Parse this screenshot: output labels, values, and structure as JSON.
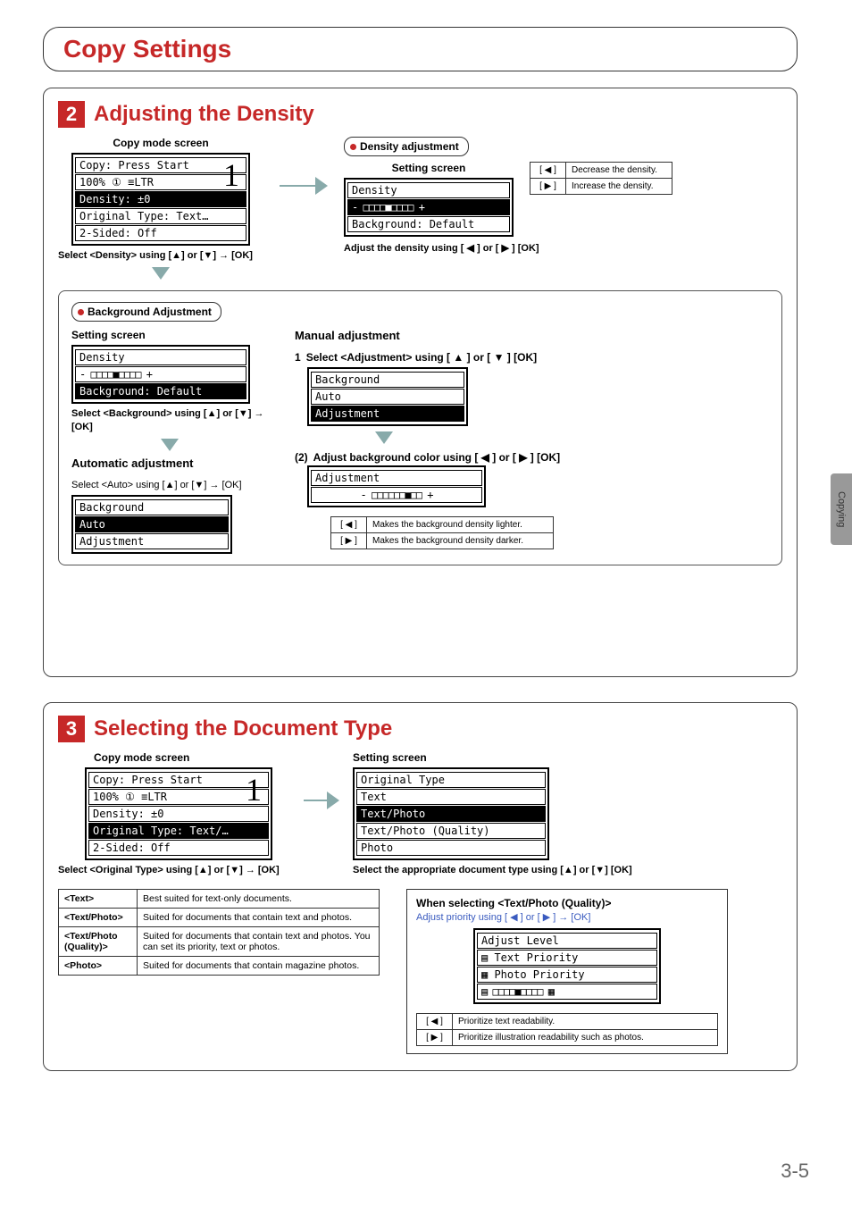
{
  "page": {
    "number": "3-5",
    "sideTab": "Copying"
  },
  "title": "Copy Settings",
  "s2": {
    "num": "2",
    "title": "Adjusting the Density",
    "copyScreen": {
      "label": "Copy mode screen",
      "l1": "Copy: Press Start",
      "l2": "100% ① ≡LTR",
      "l3": "Density: ±0",
      "l4": "Original Type: Text…",
      "l5": "2-Sided: Off",
      "big": "1",
      "instruction": "Select <Density> using [▲] or [▼] → [OK]"
    },
    "densityAdj": {
      "tab": "Density adjustment",
      "label": "Setting screen",
      "l1": "Density",
      "l2": "- □□□□■□□□□ +",
      "l3": "Background: Default",
      "keys": {
        "left": "[ ◀ ]",
        "leftDesc": "Decrease the density.",
        "right": "[ ▶ ]",
        "rightDesc": "Increase the density."
      },
      "instruction": "Adjust the density using [ ◀ ] or [ ▶ ]  [OK]"
    },
    "bgAdj": {
      "tab": "Background Adjustment",
      "label": "Setting screen",
      "l1": "Density",
      "l2": "- □□□□■□□□□ +",
      "l3": "Background: Default",
      "instruction": "Select <Background> using [▲] or [▼] → [OK]"
    },
    "auto": {
      "title": "Automatic adjustment",
      "instruction": "Select <Auto> using [▲] or [▼] → [OK]",
      "l1": "Background",
      "l2": "Auto",
      "l3": "Adjustment"
    },
    "manual": {
      "title": "Manual adjustment",
      "step1": "Select <Adjustment> using [ ▲ ] or [ ▼ ]     [OK]",
      "step1Num": "1",
      "lcd1_l1": "Background",
      "lcd1_l2": "Auto",
      "lcd1_l3": "Adjustment",
      "step2Num": "(2)",
      "step2": "Adjust background color using [ ◀ ] or [ ▶ ]     [OK]",
      "lcd2_l1": "Adjustment",
      "lcd2_l2": "- □□□□□□■□□ +",
      "keys": {
        "left": "[ ◀ ]",
        "leftDesc": "Makes the background density lighter.",
        "right": "[ ▶ ]",
        "rightDesc": "Makes the background density darker."
      }
    }
  },
  "s3": {
    "num": "3",
    "title": "Selecting the Document Type",
    "copyScreen": {
      "label": "Copy mode screen",
      "l1": "Copy: Press Start",
      "l2": "100% ① ≡LTR",
      "l3": "Density: ±0",
      "l4": "Original Type: Text/…",
      "l5": "2-Sided: Off",
      "big": "1",
      "instruction": "Select <Original Type> using [▲] or [▼] → [OK]"
    },
    "setScreen": {
      "label": "Setting screen",
      "l1": "Original Type",
      "l2": "Text",
      "l3": "Text/Photo",
      "l4": "Text/Photo (Quality)",
      "l5": "Photo",
      "instruction": "Select the appropriate document type using [▲] or [▼] [OK]"
    },
    "table": {
      "r1k": "<Text>",
      "r1v": "Best suited for text-only documents.",
      "r2k": "<Text/Photo>",
      "r2v": "Suited for documents that contain text and photos.",
      "r3k": "<Text/Photo (Quality)>",
      "r3v": "Suited for documents that contain text and photos. You can set its priority, text or photos.",
      "r4k": "<Photo>",
      "r4v": "Suited for documents that contain magazine photos."
    },
    "quality": {
      "title": "When selecting <Text/Photo (Quality)>",
      "sub": "Adjust priority using [ ◀ ] or [ ▶ ] → [OK]",
      "l1": "Adjust Level",
      "l2": "▤ Text Priority",
      "l3": "▦ Photo Priority",
      "l4": "▤ □□□□■□□□□ ▦",
      "keys": {
        "left": "[ ◀ ]",
        "leftDesc": "Prioritize text readability.",
        "right": "[ ▶ ]",
        "rightDesc": "Prioritize illustration readability such as photos."
      }
    }
  }
}
